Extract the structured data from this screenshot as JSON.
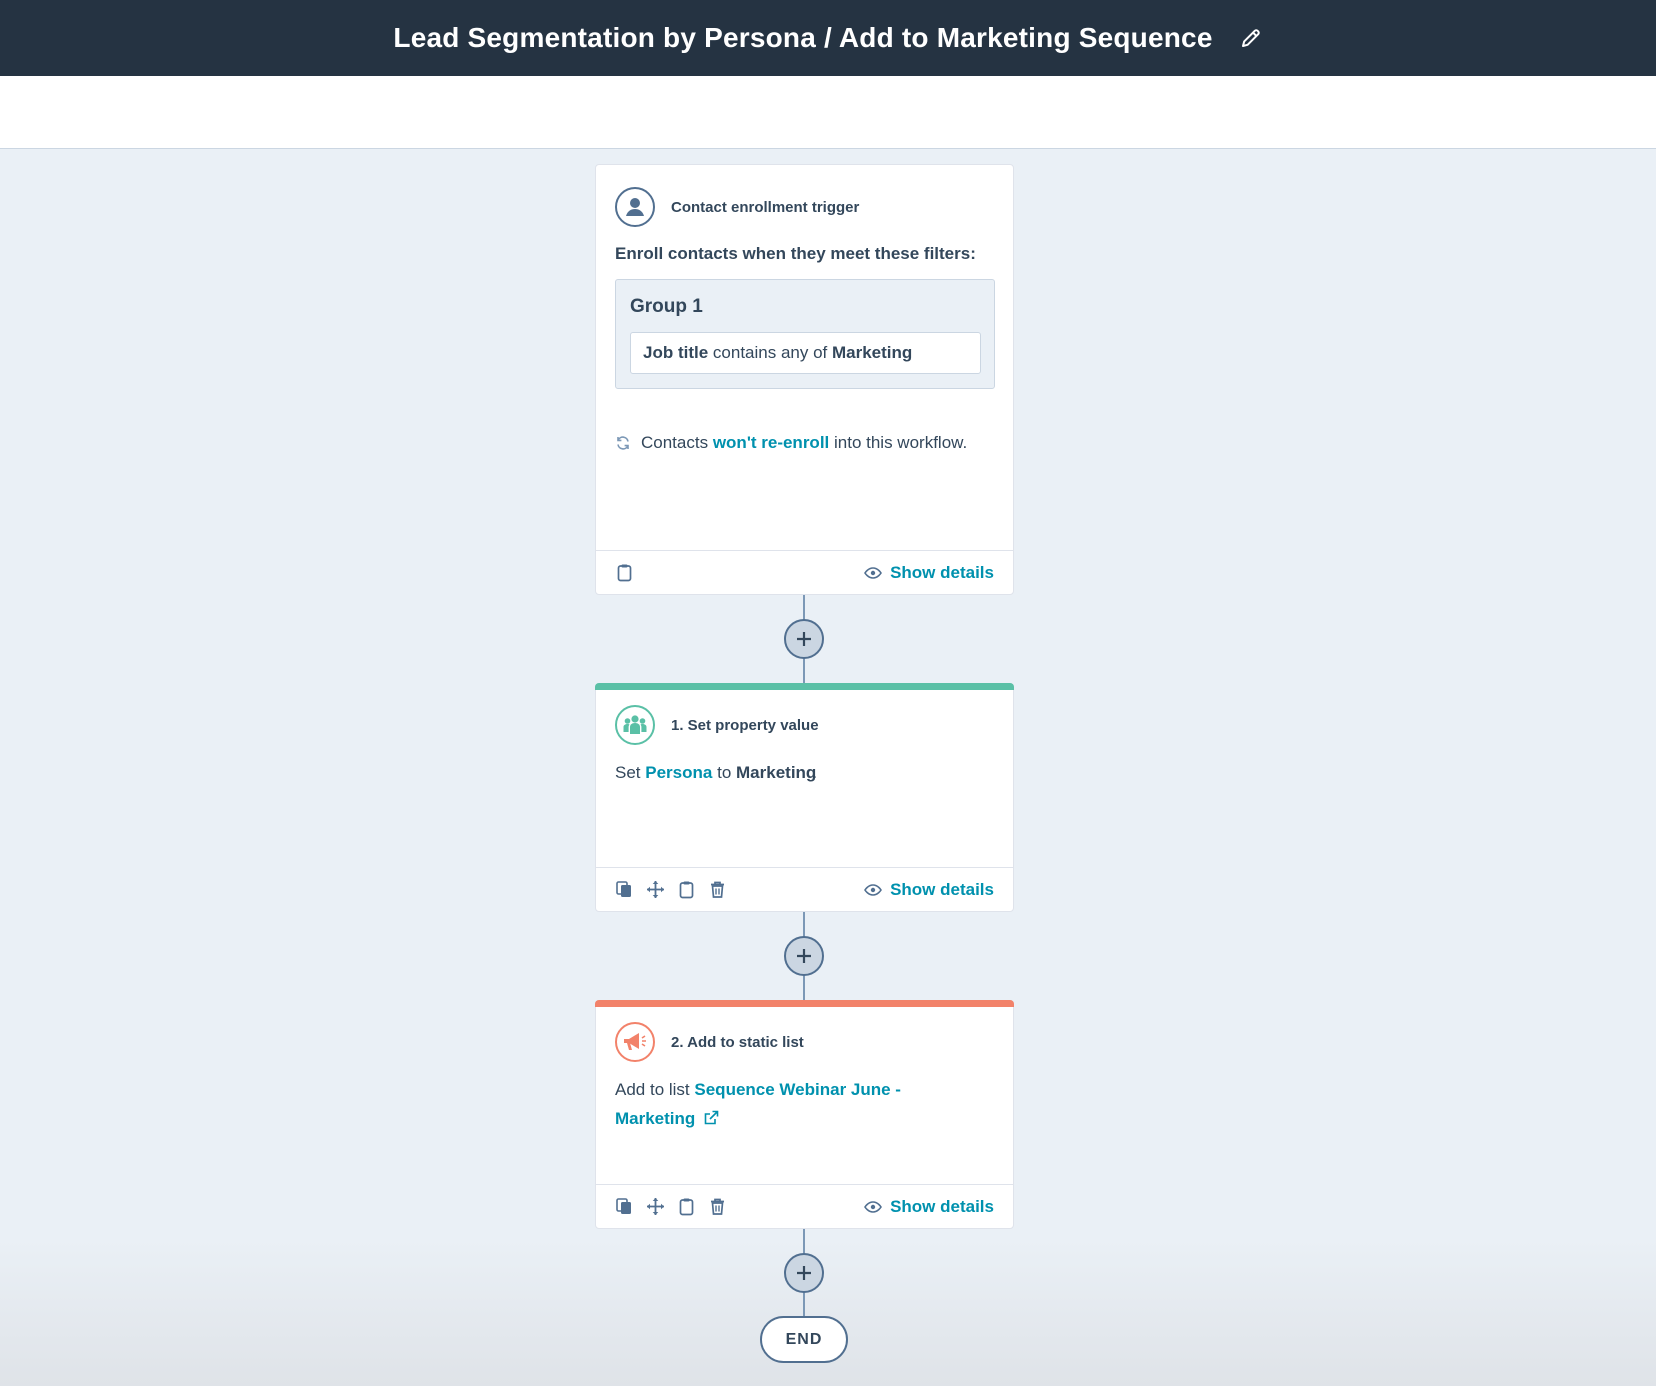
{
  "header": {
    "title": "Lead Segmentation by Persona / Add to Marketing Sequence",
    "edit_icon": "pencil-icon"
  },
  "trigger": {
    "label": "Contact enrollment trigger",
    "icon": "contact-avatar-icon",
    "intro": "Enroll contacts when they meet these filters:",
    "group_title": "Group 1",
    "filter": {
      "property": "Job title",
      "operator": "contains any of",
      "value": "Marketing"
    },
    "reenroll": {
      "prefix": "Contacts",
      "link": "won't re-enroll",
      "suffix": "into this workflow."
    },
    "show_details": "Show details"
  },
  "actions": [
    {
      "label": "1. Set property value",
      "icon": "people-icon",
      "accent": "#5ac0a6",
      "text": {
        "prefix": "Set",
        "property": "Persona",
        "middle": "to",
        "value": "Marketing",
        "suffix": "."
      },
      "show_details": "Show details"
    },
    {
      "label": "2. Add to static list",
      "icon": "megaphone-icon",
      "accent": "#f2826a",
      "text": {
        "prefix": "Add to list",
        "list_name": "Sequence Webinar June - Marketing"
      },
      "show_details": "Show details"
    }
  ],
  "end_label": "END",
  "colors": {
    "header_bg": "#253342",
    "canvas_bg": "#eaf0f6",
    "link": "#0091ae",
    "text": "#33475b"
  }
}
